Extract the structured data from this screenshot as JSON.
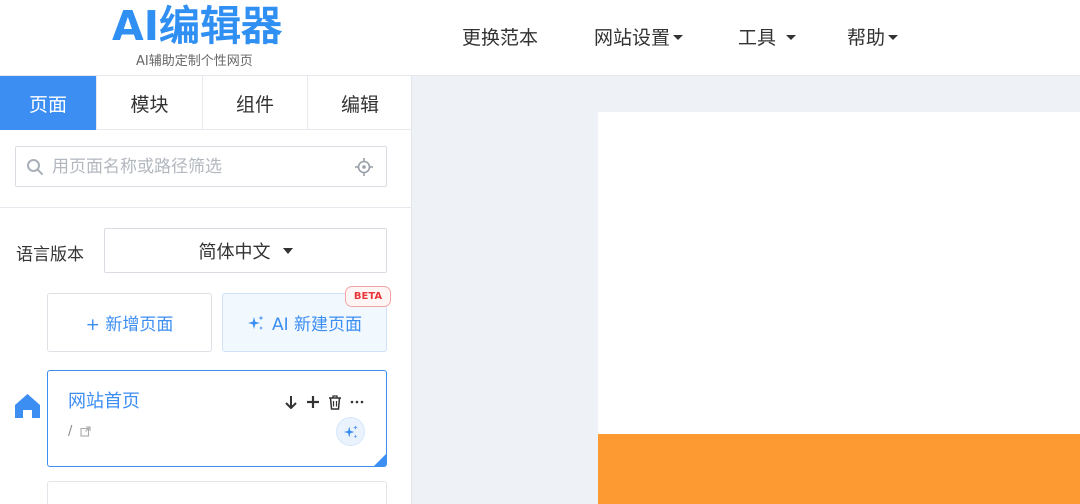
{
  "header": {
    "logo_title": "AI编辑器",
    "logo_subtitle": "AI辅助定制个性网页",
    "nav": [
      "更换范本",
      "网站设置",
      "工具",
      "帮助"
    ]
  },
  "sidebar": {
    "tabs": [
      "页面",
      "模块",
      "组件",
      "编辑"
    ],
    "active_tab": "页面",
    "search": {
      "placeholder": "用页面名称或路径筛选",
      "value": ""
    },
    "language": {
      "label": "语言版本",
      "selected": "简体中文"
    },
    "add_page_label": "+ 新增页面",
    "ai_page_label": "AI 新建页面",
    "beta_badge": "BETA",
    "pages": [
      {
        "name": "网站首页",
        "path": "/"
      }
    ]
  },
  "colors": {
    "accent": "#3c8ef3",
    "logo": "#2f8ff2",
    "banner": "#fd9a32",
    "beta": "#e8383b",
    "workspace_bg": "#eef2f6"
  },
  "icons": [
    "search-icon",
    "locate-icon",
    "sparkle-icon",
    "home-icon",
    "move-down-icon",
    "plus-icon",
    "trash-icon",
    "more-icon",
    "external-link-icon"
  ]
}
